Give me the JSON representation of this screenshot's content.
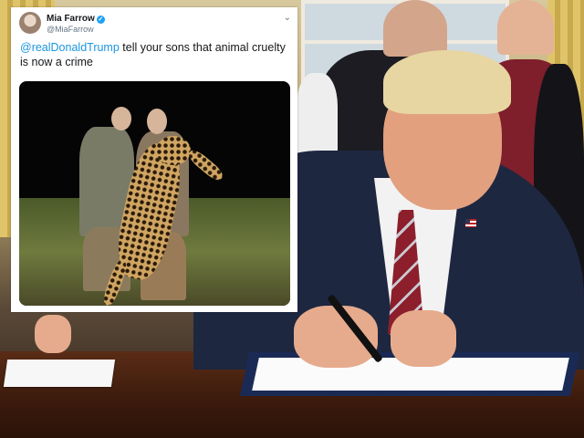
{
  "tweet": {
    "author_name": "Mia Farrow",
    "verified_icon": "verified-badge-icon",
    "handle": "@MiaFarrow",
    "menu_icon": "chevron-down-icon",
    "text_mention": "@realDonaldTrump",
    "text_body": " tell your sons  that animal cruelty is now a crime",
    "media_icon": "hunting-photo"
  },
  "colors": {
    "mention": "#1b95e0",
    "verified": "#1da1f2",
    "suit": "#1d2740",
    "tie": "#8c1f2b"
  }
}
